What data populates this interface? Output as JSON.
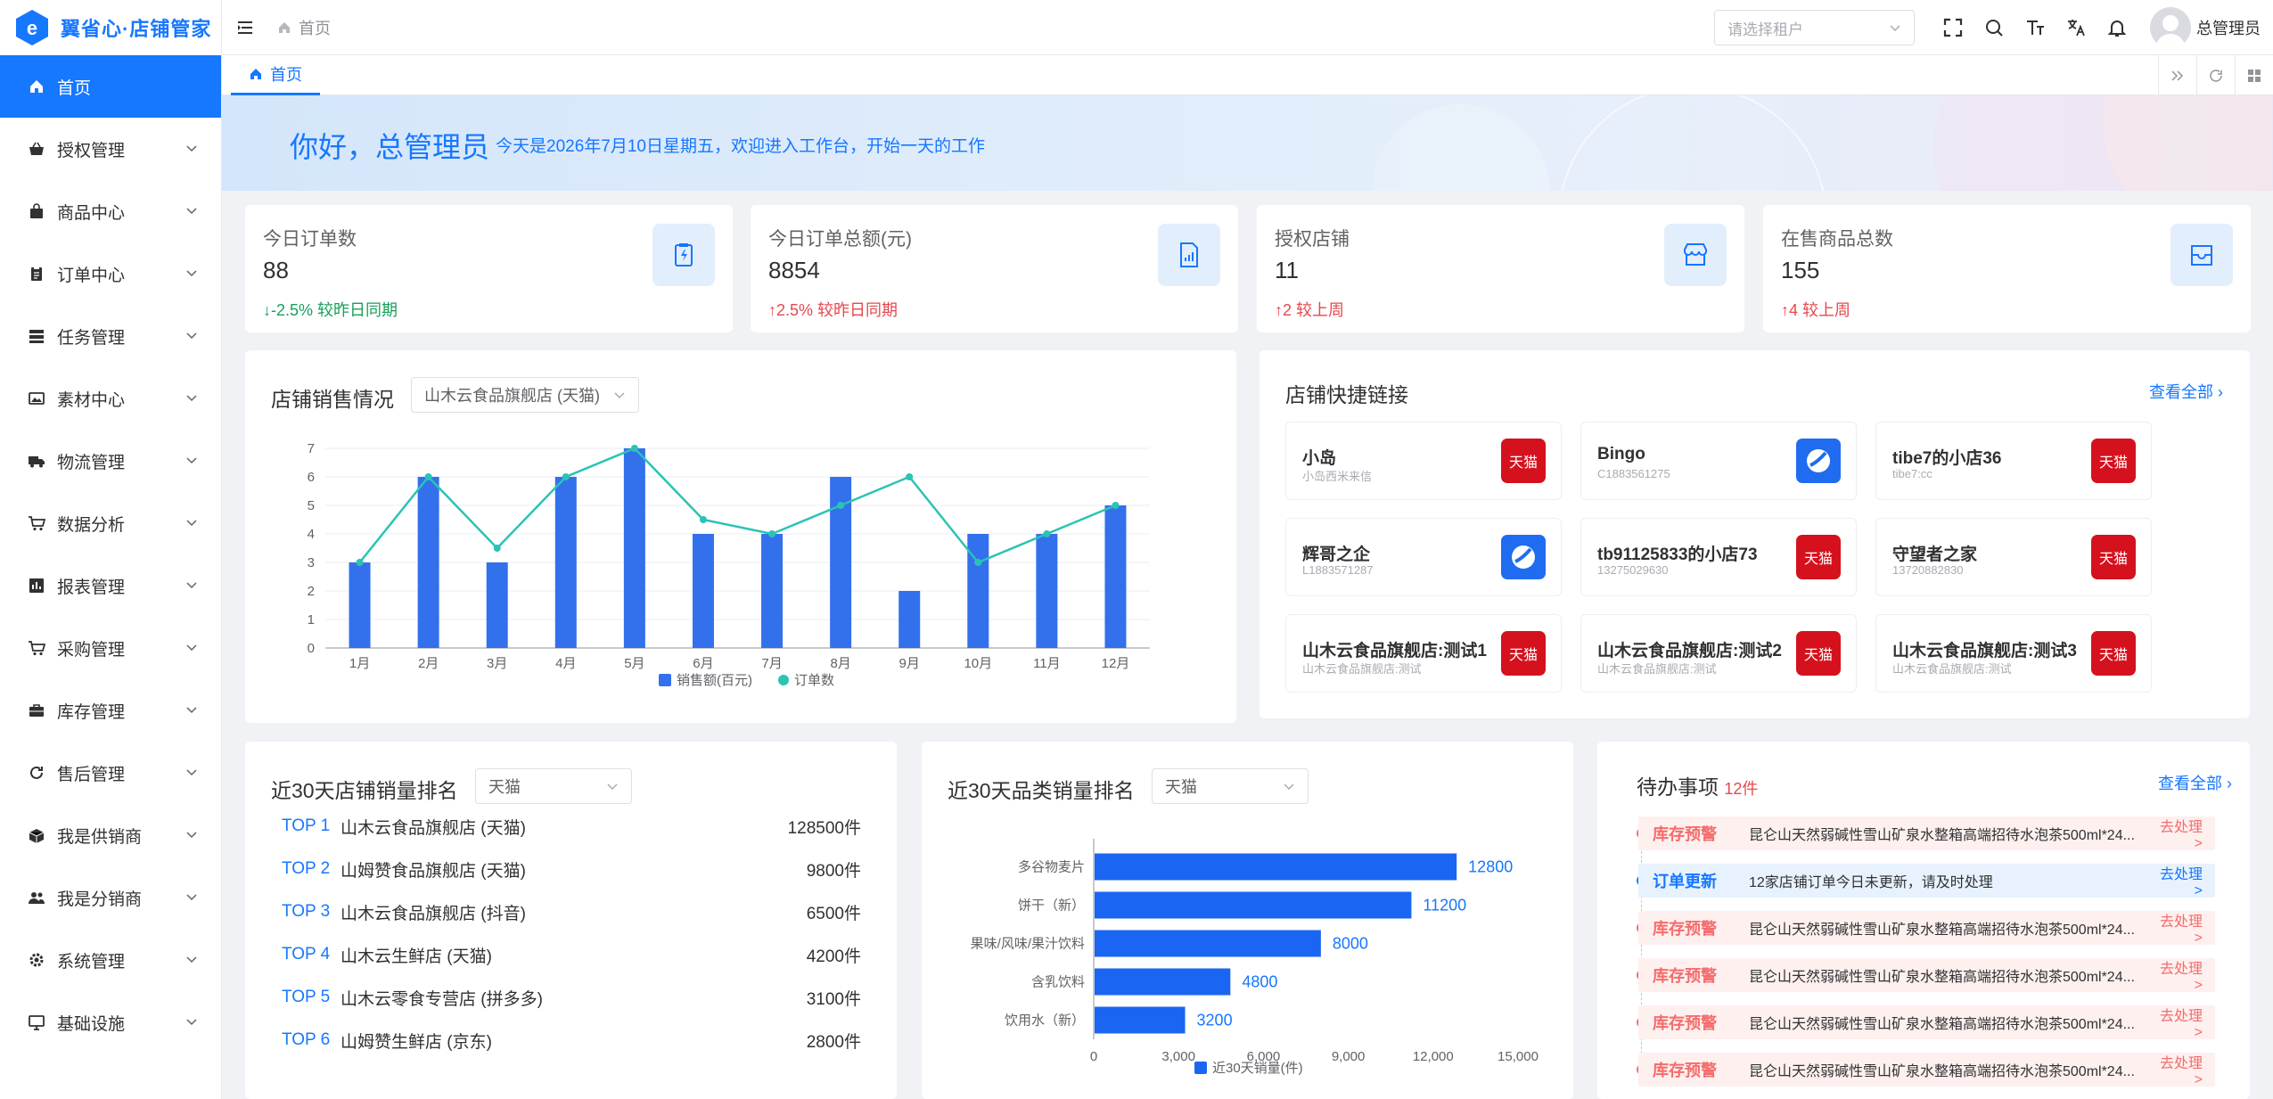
{
  "app": {
    "name": "翼省心·店铺管家"
  },
  "sidebar": {
    "items": [
      {
        "label": "首页",
        "icon": "home-icon"
      },
      {
        "label": "授权管理",
        "icon": "basket-icon"
      },
      {
        "label": "商品中心",
        "icon": "bag-icon"
      },
      {
        "label": "订单中心",
        "icon": "clipboard-icon"
      },
      {
        "label": "任务管理",
        "icon": "server-icon"
      },
      {
        "label": "素材中心",
        "icon": "image-icon"
      },
      {
        "label": "物流管理",
        "icon": "truck-icon"
      },
      {
        "label": "数据分析",
        "icon": "cart-icon"
      },
      {
        "label": "报表管理",
        "icon": "bar-chart-icon"
      },
      {
        "label": "采购管理",
        "icon": "cart-icon"
      },
      {
        "label": "库存管理",
        "icon": "briefcase-icon"
      },
      {
        "label": "售后管理",
        "icon": "refresh-icon"
      },
      {
        "label": "我是供销商",
        "icon": "box-icon"
      },
      {
        "label": "我是分销商",
        "icon": "users-icon"
      },
      {
        "label": "系统管理",
        "icon": "gear-icon"
      },
      {
        "label": "基础设施",
        "icon": "monitor-icon"
      }
    ]
  },
  "header": {
    "breadcrumb": "首页",
    "tenant_placeholder": "请选择租户",
    "user_name": "总管理员"
  },
  "tabs": {
    "home": "首页"
  },
  "banner": {
    "greeting": "你好，总管理员",
    "message": "今天是2026年7月10日星期五，欢迎进入工作台，开始一天的工作"
  },
  "stats": [
    {
      "label": "今日订单数",
      "value": "88",
      "compare": "↓-2.5% 较昨日同期",
      "trend": "down",
      "icon": "clipboard-bolt-icon"
    },
    {
      "label": "今日订单总额(元)",
      "value": "8854",
      "compare": "↑2.5% 较昨日同期",
      "trend": "up",
      "icon": "report-icon"
    },
    {
      "label": "授权店铺",
      "value": "11",
      "compare": "↑2 较上周",
      "trend": "up",
      "icon": "store-icon"
    },
    {
      "label": "在售商品总数",
      "value": "155",
      "compare": "↑4 较上周",
      "trend": "up",
      "icon": "inbox-icon"
    }
  ],
  "sales_chart": {
    "title": "店铺销售情况",
    "shop_select": "山木云食品旗舰店 (天猫)"
  },
  "chart_data": [
    {
      "type": "bar",
      "categories": [
        "1月",
        "2月",
        "3月",
        "4月",
        "5月",
        "6月",
        "7月",
        "8月",
        "9月",
        "10月",
        "11月",
        "12月"
      ],
      "series": [
        {
          "name": "销售额(百元)",
          "type": "bar",
          "values": [
            3,
            6,
            3,
            6,
            7,
            4,
            4,
            6,
            2,
            4,
            4,
            5
          ]
        },
        {
          "name": "订单数",
          "type": "line",
          "values": [
            3,
            6,
            3.5,
            6,
            7,
            4.5,
            4,
            5,
            6,
            3,
            4,
            5
          ]
        }
      ],
      "ylim": [
        0,
        7
      ],
      "yticks": [
        0,
        1,
        2,
        3,
        4,
        5,
        6,
        7
      ],
      "legend": "bottom"
    },
    {
      "type": "bar",
      "orientation": "horizontal",
      "categories": [
        "多谷物麦片",
        "饼干（新）",
        "果味/风味/果汁饮料",
        "含乳饮料",
        "饮用水（新）"
      ],
      "series": [
        {
          "name": "近30天销量(件)",
          "values": [
            12800,
            11200,
            8000,
            4800,
            3200
          ]
        }
      ],
      "xlim": [
        0,
        15000
      ],
      "xticks": [
        "0",
        "3,000",
        "6,000",
        "9,000",
        "12,000",
        "15,000"
      ],
      "legend": "bottom"
    }
  ],
  "quick_links": {
    "title": "店铺快捷链接",
    "view_all": "查看全部",
    "shops": [
      {
        "name": "小岛",
        "id": "小岛西米来信",
        "platform": "天猫"
      },
      {
        "name": "Bingo",
        "id": "C1883561275",
        "platform": ""
      },
      {
        "name": "tibe7的小店36",
        "id": "tibe7:cc",
        "platform": "天猫"
      },
      {
        "name": "辉哥之企",
        "id": "L1883571287",
        "platform": ""
      },
      {
        "name": "tb91125833的小店73",
        "id": "13275029630",
        "platform": "天猫"
      },
      {
        "name": "守望者之家",
        "id": "13720882830",
        "platform": "天猫"
      },
      {
        "name": "山木云食品旗舰店:测试1",
        "id": "山木云食品旗舰店:测试",
        "platform": "天猫"
      },
      {
        "name": "山木云食品旗舰店:测试2",
        "id": "山木云食品旗舰店:测试",
        "platform": "天猫"
      },
      {
        "name": "山木云食品旗舰店:测试3",
        "id": "山木云食品旗舰店:测试",
        "platform": "天猫"
      }
    ]
  },
  "shop_rank": {
    "title": "近30天店铺销量排名",
    "platform": "天猫",
    "rows": [
      {
        "rank": "TOP 1",
        "name": "山木云食品旗舰店 (天猫)",
        "value": "128500件"
      },
      {
        "rank": "TOP 2",
        "name": "山姆赞食品旗舰店 (天猫)",
        "value": "9800件"
      },
      {
        "rank": "TOP 3",
        "name": "山木云食品旗舰店 (抖音)",
        "value": "6500件"
      },
      {
        "rank": "TOP 4",
        "name": "山木云生鲜店 (天猫)",
        "value": "4200件"
      },
      {
        "rank": "TOP 5",
        "name": "山木云零食专营店 (拼多多)",
        "value": "3100件"
      },
      {
        "rank": "TOP 6",
        "name": "山姆赞生鲜店 (京东)",
        "value": "2800件"
      }
    ]
  },
  "category_rank": {
    "title": "近30天品类销量排名",
    "platform": "天猫"
  },
  "todos": {
    "title": "待办事项",
    "count": "12件",
    "view_all": "查看全部",
    "items": [
      {
        "type": "库存预警",
        "kind": "warn",
        "content": "昆仑山天然弱碱性雪山矿泉水整箱高端招待水泡茶500ml*24...",
        "action": "去处理>"
      },
      {
        "type": "订单更新",
        "kind": "info",
        "content": "12家店铺订单今日未更新，请及时处理",
        "action": "去处理>"
      },
      {
        "type": "库存预警",
        "kind": "warn",
        "content": "昆仑山天然弱碱性雪山矿泉水整箱高端招待水泡茶500ml*24...",
        "action": "去处理>"
      },
      {
        "type": "库存预警",
        "kind": "warn",
        "content": "昆仑山天然弱碱性雪山矿泉水整箱高端招待水泡茶500ml*24...",
        "action": "去处理>"
      },
      {
        "type": "库存预警",
        "kind": "warn",
        "content": "昆仑山天然弱碱性雪山矿泉水整箱高端招待水泡茶500ml*24...",
        "action": "去处理>"
      },
      {
        "type": "库存预警",
        "kind": "warn",
        "content": "昆仑山天然弱碱性雪山矿泉水整箱高端招待水泡茶500ml*24...",
        "action": "去处理>"
      }
    ]
  },
  "colors": {
    "primary": "#1677ff",
    "bar": "#3370ec",
    "line": "#2ac3b4",
    "up": "#e5484d",
    "down": "#18a058",
    "tmall": "#d5111e"
  }
}
